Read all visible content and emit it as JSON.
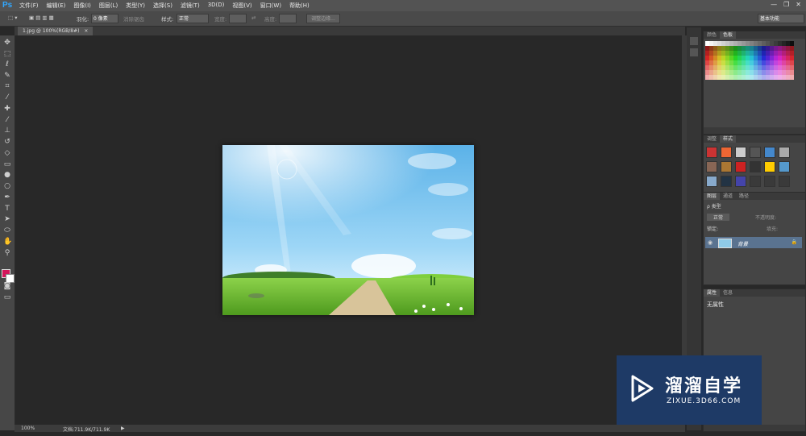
{
  "app": {
    "logo": "Ps"
  },
  "menu": [
    "文件(F)",
    "编辑(E)",
    "图像(I)",
    "图层(L)",
    "类型(Y)",
    "选择(S)",
    "滤镜(T)",
    "3D(D)",
    "视图(V)",
    "窗口(W)",
    "帮助(H)"
  ],
  "window_controls": [
    "—",
    "❐",
    "✕"
  ],
  "options": {
    "feather_label": "羽化:",
    "feather_value": "0 像素",
    "antialias": "消除锯齿",
    "style_label": "样式:",
    "style_value": "正常",
    "width_label": "宽度:",
    "height_label": "高度:",
    "refine": "调整边缘...",
    "workspace": "基本功能"
  },
  "document": {
    "tab": "1.jpg @ 100%(RGB/8#)",
    "close": "×"
  },
  "status": {
    "zoom": "100%",
    "doc": "文档:711.9K/711.9K",
    "arrow": "▶"
  },
  "panels": {
    "color_tabs": [
      "颜色",
      "色板"
    ],
    "adjust_tabs": [
      "调整",
      "样式"
    ],
    "layer_tabs": [
      "图层",
      "通道",
      "路径"
    ],
    "layer_kind": "ρ 类型",
    "blend_mode": "正常",
    "opacity_label": "不透明度:",
    "lock_label": "锁定:",
    "fill_label": "填充:",
    "layer_name": "背景",
    "props_tabs": [
      "属性",
      "信息"
    ],
    "props_text": "无属性"
  },
  "watermark": {
    "title": "溜溜自学",
    "url": "ZIXUE.3D66.COM"
  },
  "colors": {
    "accent": "#31a8ff",
    "foreground": "#d4145a",
    "background": "#ffffff",
    "watermark_bg": "#1e3a66"
  },
  "tool_icons": [
    "move-icon",
    "marquee-icon",
    "lasso-icon",
    "quick-select-icon",
    "crop-icon",
    "eyedropper-icon",
    "healing-icon",
    "brush-icon",
    "stamp-icon",
    "history-brush-icon",
    "eraser-icon",
    "gradient-icon",
    "blur-icon",
    "dodge-icon",
    "pen-icon",
    "type-icon",
    "path-select-icon",
    "shape-icon",
    "hand-icon",
    "zoom-icon"
  ]
}
